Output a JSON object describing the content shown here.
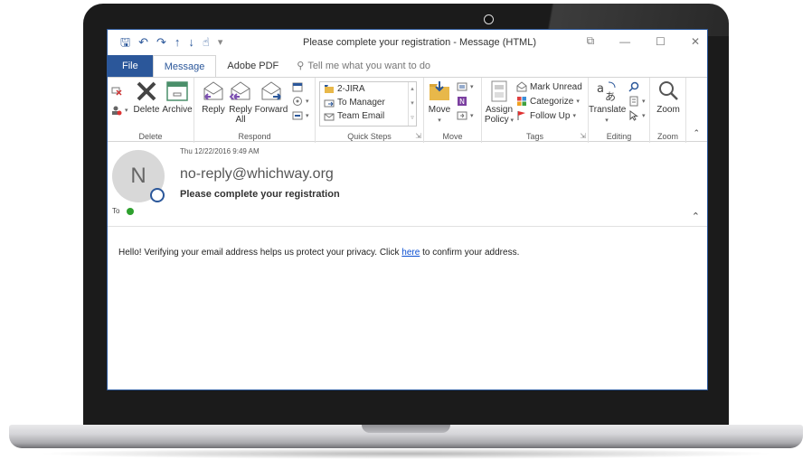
{
  "window": {
    "title": "Please complete your registration  -  Message (HTML)",
    "controls": {
      "restore": "⧉",
      "minimize": "—",
      "maximize": "☐",
      "close": "✕"
    }
  },
  "qat": {
    "save": "🖫",
    "undo": "↶",
    "redo": "↷",
    "up": "↑",
    "down": "↓",
    "touch": "☝",
    "more": "▾"
  },
  "tabs": {
    "file": "File",
    "message": "Message",
    "adobe": "Adobe PDF",
    "tell_me": "Tell me what you want to do"
  },
  "ribbon": {
    "delete_group": {
      "label": "Delete",
      "delete": "Delete",
      "archive": "Archive"
    },
    "respond_group": {
      "label": "Respond",
      "reply": "Reply",
      "reply_all_line1": "Reply",
      "reply_all_line2": "All",
      "forward": "Forward"
    },
    "quick_steps": {
      "label": "Quick Steps",
      "items": [
        "2-JIRA",
        "To Manager",
        "Team Email"
      ]
    },
    "move_group": {
      "label": "Move",
      "move": "Move"
    },
    "tags_group": {
      "label": "Tags",
      "assign_line1": "Assign",
      "assign_line2": "Policy",
      "mark_unread": "Mark Unread",
      "categorize": "Categorize",
      "follow_up": "Follow Up"
    },
    "editing_group": {
      "label": "Editing",
      "translate": "Translate"
    },
    "zoom_group": {
      "label": "Zoom",
      "zoom": "Zoom"
    }
  },
  "message": {
    "timestamp": "Thu 12/22/2016 9:49 AM",
    "avatar_initial": "N",
    "sender": "no-reply@whichway.org",
    "subject": "Please complete your registration",
    "to_label": "To",
    "body_before": "Hello! Verifying your email address helps us protect your privacy. Click ",
    "link_text": "here",
    "body_after": " to confirm your address."
  },
  "colors": {
    "accent": "#2b579a",
    "link": "#0b4fd1",
    "laptop_bezel": "#1b1b1b"
  }
}
